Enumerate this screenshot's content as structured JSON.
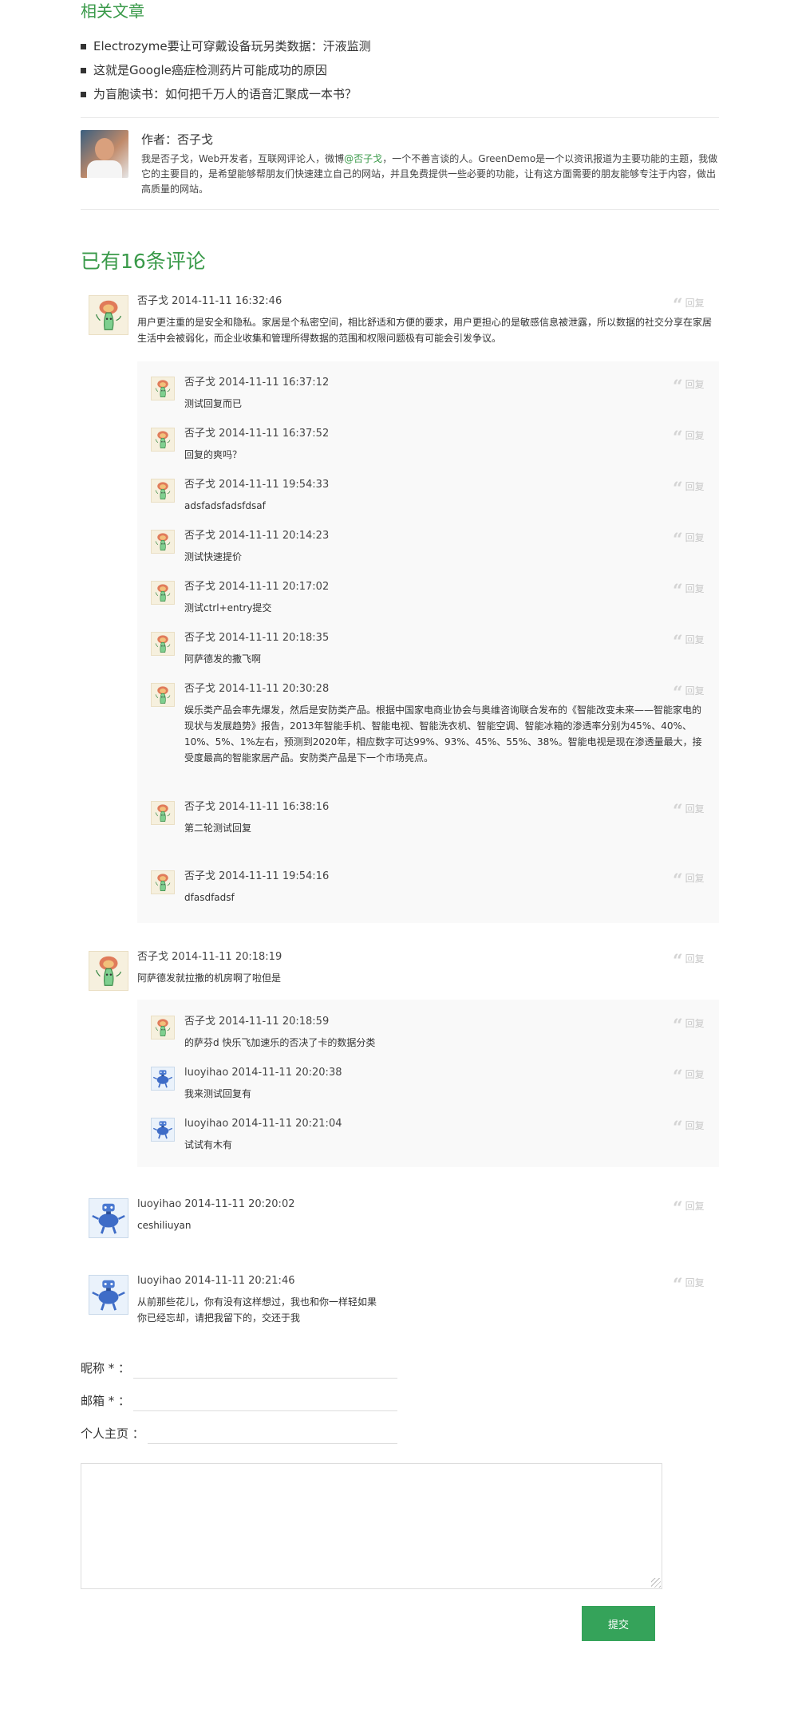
{
  "related": {
    "title": "相关文章",
    "items": [
      "Electrozyme要让可穿戴设备玩另类数据：汗液监测",
      "这就是Google癌症检测药片可能成功的原因",
      "为盲胞读书：如何把千万人的语音汇聚成一本书？"
    ]
  },
  "author": {
    "label": "作者：否子戈",
    "bio_before": "我是否子戈，Web开发者，互联网评论人，微博",
    "bio_link": "@否子戈",
    "bio_after": "，一个不善言谈的人。GreenDemo是一个以资讯报道为主要功能的主题，我做它的主要目的，是希望能够帮朋友们快速建立自己的网站，并且免费提供一些必要的功能，让有这方面需要的朋友能够专注于内容，做出高质量的网站。"
  },
  "comments_title": "已有16条评论",
  "reply_label": "回复",
  "comments": [
    {
      "author": "否子戈",
      "time": "2014-11-11 16:32:46",
      "text": "用户更注重的是安全和隐私。家居是个私密空间，相比舒适和方便的要求，用户更担心的是敏感信息被泄露，所以数据的社交分享在家居生活中会被弱化，而企业收集和管理所得数据的范围和权限问题极有可能会引发争议。"
    },
    {
      "author": "否子戈",
      "time": "2014-11-11 16:37:12",
      "text": "测试回复而已"
    },
    {
      "author": "否子戈",
      "time": "2014-11-11 16:37:52",
      "text": "回复的爽吗？"
    },
    {
      "author": "否子戈",
      "time": "2014-11-11 19:54:33",
      "text": "adsfadsfadsfdsaf"
    },
    {
      "author": "否子戈",
      "time": "2014-11-11 20:14:23",
      "text": "测试快速提价"
    },
    {
      "author": "否子戈",
      "time": "2014-11-11 20:17:02",
      "text": "测试ctrl+entry提交"
    },
    {
      "author": "否子戈",
      "time": "2014-11-11 20:18:35",
      "text": "阿萨德发的撒飞啊"
    },
    {
      "author": "否子戈",
      "time": "2014-11-11 20:30:28",
      "text": "娱乐类产品会率先爆发，然后是安防类产品。根据中国家电商业协会与奥维咨询联合发布的《智能改变未来——智能家电的现状与发展趋势》报告，2013年智能手机、智能电视、智能洗衣机、智能空调、智能冰箱的渗透率分别为45%、40%、10%、5%、1%左右，预测到2020年，相应数字可达99%、93%、45%、55%、38%。智能电视是现在渗透量最大，接受度最高的智能家居产品。安防类产品是下一个市场亮点。"
    },
    {
      "author": "否子戈",
      "time": "2014-11-11 16:38:16",
      "text": "第二轮测试回复"
    },
    {
      "author": "否子戈",
      "time": "2014-11-11 19:54:16",
      "text": "dfasdfadsf"
    },
    {
      "author": "否子戈",
      "time": "2014-11-11 20:18:19",
      "text": "阿萨德发就拉撒的机房啊了啦但是"
    },
    {
      "author": "否子戈",
      "time": "2014-11-11 20:18:59",
      "text": "的萨芬d 快乐飞加速乐的否决了卡的数据分类"
    },
    {
      "author": "luoyihao",
      "time": "2014-11-11 20:20:38",
      "text": "我来测试回复有"
    },
    {
      "author": "luoyihao",
      "time": "2014-11-11 20:21:04",
      "text": "试试有木有"
    },
    {
      "author": "luoyihao",
      "time": "2014-11-11 20:20:02",
      "text": "ceshiliuyan"
    },
    {
      "author": "luoyihao",
      "time": "2014-11-11 20:21:46",
      "text": "从前那些花儿，你有没有这样想过，我也和你一样轻如果你已经忘却，请把我留下的，交还于我"
    }
  ],
  "form": {
    "nickname_label": "昵称 * ：",
    "email_label": "邮箱 * ：",
    "homepage_label": "个人主页 ：",
    "submit_label": "提交"
  }
}
